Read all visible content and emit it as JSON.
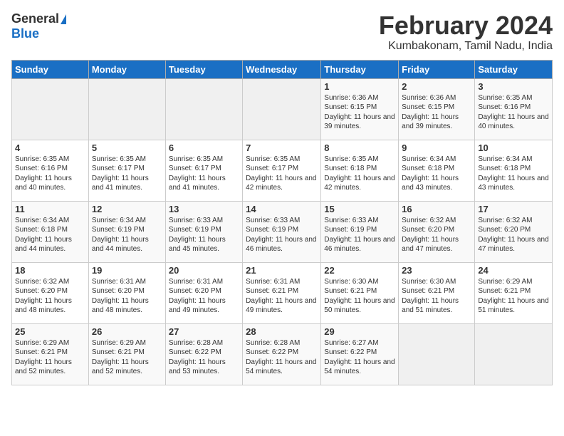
{
  "logo": {
    "general": "General",
    "blue": "Blue"
  },
  "title": "February 2024",
  "subtitle": "Kumbakonam, Tamil Nadu, India",
  "header_days": [
    "Sunday",
    "Monday",
    "Tuesday",
    "Wednesday",
    "Thursday",
    "Friday",
    "Saturday"
  ],
  "weeks": [
    [
      {
        "day": "",
        "info": ""
      },
      {
        "day": "",
        "info": ""
      },
      {
        "day": "",
        "info": ""
      },
      {
        "day": "",
        "info": ""
      },
      {
        "day": "1",
        "info": "Sunrise: 6:36 AM\nSunset: 6:15 PM\nDaylight: 11 hours and 39 minutes."
      },
      {
        "day": "2",
        "info": "Sunrise: 6:36 AM\nSunset: 6:15 PM\nDaylight: 11 hours and 39 minutes."
      },
      {
        "day": "3",
        "info": "Sunrise: 6:35 AM\nSunset: 6:16 PM\nDaylight: 11 hours and 40 minutes."
      }
    ],
    [
      {
        "day": "4",
        "info": "Sunrise: 6:35 AM\nSunset: 6:16 PM\nDaylight: 11 hours and 40 minutes."
      },
      {
        "day": "5",
        "info": "Sunrise: 6:35 AM\nSunset: 6:17 PM\nDaylight: 11 hours and 41 minutes."
      },
      {
        "day": "6",
        "info": "Sunrise: 6:35 AM\nSunset: 6:17 PM\nDaylight: 11 hours and 41 minutes."
      },
      {
        "day": "7",
        "info": "Sunrise: 6:35 AM\nSunset: 6:17 PM\nDaylight: 11 hours and 42 minutes."
      },
      {
        "day": "8",
        "info": "Sunrise: 6:35 AM\nSunset: 6:18 PM\nDaylight: 11 hours and 42 minutes."
      },
      {
        "day": "9",
        "info": "Sunrise: 6:34 AM\nSunset: 6:18 PM\nDaylight: 11 hours and 43 minutes."
      },
      {
        "day": "10",
        "info": "Sunrise: 6:34 AM\nSunset: 6:18 PM\nDaylight: 11 hours and 43 minutes."
      }
    ],
    [
      {
        "day": "11",
        "info": "Sunrise: 6:34 AM\nSunset: 6:18 PM\nDaylight: 11 hours and 44 minutes."
      },
      {
        "day": "12",
        "info": "Sunrise: 6:34 AM\nSunset: 6:19 PM\nDaylight: 11 hours and 44 minutes."
      },
      {
        "day": "13",
        "info": "Sunrise: 6:33 AM\nSunset: 6:19 PM\nDaylight: 11 hours and 45 minutes."
      },
      {
        "day": "14",
        "info": "Sunrise: 6:33 AM\nSunset: 6:19 PM\nDaylight: 11 hours and 46 minutes."
      },
      {
        "day": "15",
        "info": "Sunrise: 6:33 AM\nSunset: 6:19 PM\nDaylight: 11 hours and 46 minutes."
      },
      {
        "day": "16",
        "info": "Sunrise: 6:32 AM\nSunset: 6:20 PM\nDaylight: 11 hours and 47 minutes."
      },
      {
        "day": "17",
        "info": "Sunrise: 6:32 AM\nSunset: 6:20 PM\nDaylight: 11 hours and 47 minutes."
      }
    ],
    [
      {
        "day": "18",
        "info": "Sunrise: 6:32 AM\nSunset: 6:20 PM\nDaylight: 11 hours and 48 minutes."
      },
      {
        "day": "19",
        "info": "Sunrise: 6:31 AM\nSunset: 6:20 PM\nDaylight: 11 hours and 48 minutes."
      },
      {
        "day": "20",
        "info": "Sunrise: 6:31 AM\nSunset: 6:20 PM\nDaylight: 11 hours and 49 minutes."
      },
      {
        "day": "21",
        "info": "Sunrise: 6:31 AM\nSunset: 6:21 PM\nDaylight: 11 hours and 49 minutes."
      },
      {
        "day": "22",
        "info": "Sunrise: 6:30 AM\nSunset: 6:21 PM\nDaylight: 11 hours and 50 minutes."
      },
      {
        "day": "23",
        "info": "Sunrise: 6:30 AM\nSunset: 6:21 PM\nDaylight: 11 hours and 51 minutes."
      },
      {
        "day": "24",
        "info": "Sunrise: 6:29 AM\nSunset: 6:21 PM\nDaylight: 11 hours and 51 minutes."
      }
    ],
    [
      {
        "day": "25",
        "info": "Sunrise: 6:29 AM\nSunset: 6:21 PM\nDaylight: 11 hours and 52 minutes."
      },
      {
        "day": "26",
        "info": "Sunrise: 6:29 AM\nSunset: 6:21 PM\nDaylight: 11 hours and 52 minutes."
      },
      {
        "day": "27",
        "info": "Sunrise: 6:28 AM\nSunset: 6:22 PM\nDaylight: 11 hours and 53 minutes."
      },
      {
        "day": "28",
        "info": "Sunrise: 6:28 AM\nSunset: 6:22 PM\nDaylight: 11 hours and 54 minutes."
      },
      {
        "day": "29",
        "info": "Sunrise: 6:27 AM\nSunset: 6:22 PM\nDaylight: 11 hours and 54 minutes."
      },
      {
        "day": "",
        "info": ""
      },
      {
        "day": "",
        "info": ""
      }
    ]
  ]
}
